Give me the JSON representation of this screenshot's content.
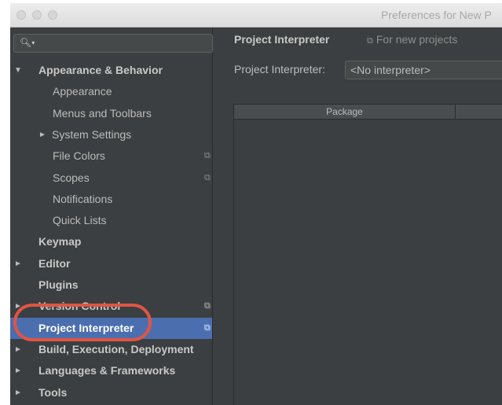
{
  "window": {
    "title": "Preferences for New P"
  },
  "sidebar": {
    "search": {
      "icon": "search-icon",
      "chevron": "▾"
    },
    "items": [
      {
        "label": "Appearance & Behavior",
        "arrow": "▼",
        "bold": true,
        "level": 0
      },
      {
        "label": "Appearance",
        "level": 2
      },
      {
        "label": "Menus and Toolbars",
        "level": 2
      },
      {
        "label": "System Settings",
        "arrow": "►",
        "level": 1
      },
      {
        "label": "File Colors",
        "level": 2,
        "copy_icon": true
      },
      {
        "label": "Scopes",
        "level": 2,
        "copy_icon": true
      },
      {
        "label": "Notifications",
        "level": 2
      },
      {
        "label": "Quick Lists",
        "level": 2
      },
      {
        "label": "Keymap",
        "bold": true,
        "level": 0
      },
      {
        "label": "Editor",
        "arrow": "►",
        "bold": true,
        "level": 0
      },
      {
        "label": "Plugins",
        "bold": true,
        "level": 0
      },
      {
        "label": "Version Control",
        "arrow": "►",
        "bold": true,
        "level": 0,
        "copy_icon": true
      },
      {
        "label": "Project Interpreter",
        "bold": true,
        "level": 0,
        "copy_icon": true,
        "selected": true
      },
      {
        "label": "Build, Execution, Deployment",
        "arrow": "►",
        "bold": true,
        "level": 0
      },
      {
        "label": "Languages & Frameworks",
        "arrow": "►",
        "bold": true,
        "level": 0
      },
      {
        "label": "Tools",
        "arrow": "►",
        "bold": true,
        "level": 0
      }
    ]
  },
  "main": {
    "title": "Project Interpreter",
    "scope_note": "For new projects",
    "interpreter_label": "Project Interpreter:",
    "interpreter_value": "<No interpreter>",
    "table": {
      "columns": [
        "Package"
      ]
    }
  },
  "colors": {
    "selection": "#4b6eaf",
    "annotation": "#e05545",
    "background": "#3c3f41"
  }
}
